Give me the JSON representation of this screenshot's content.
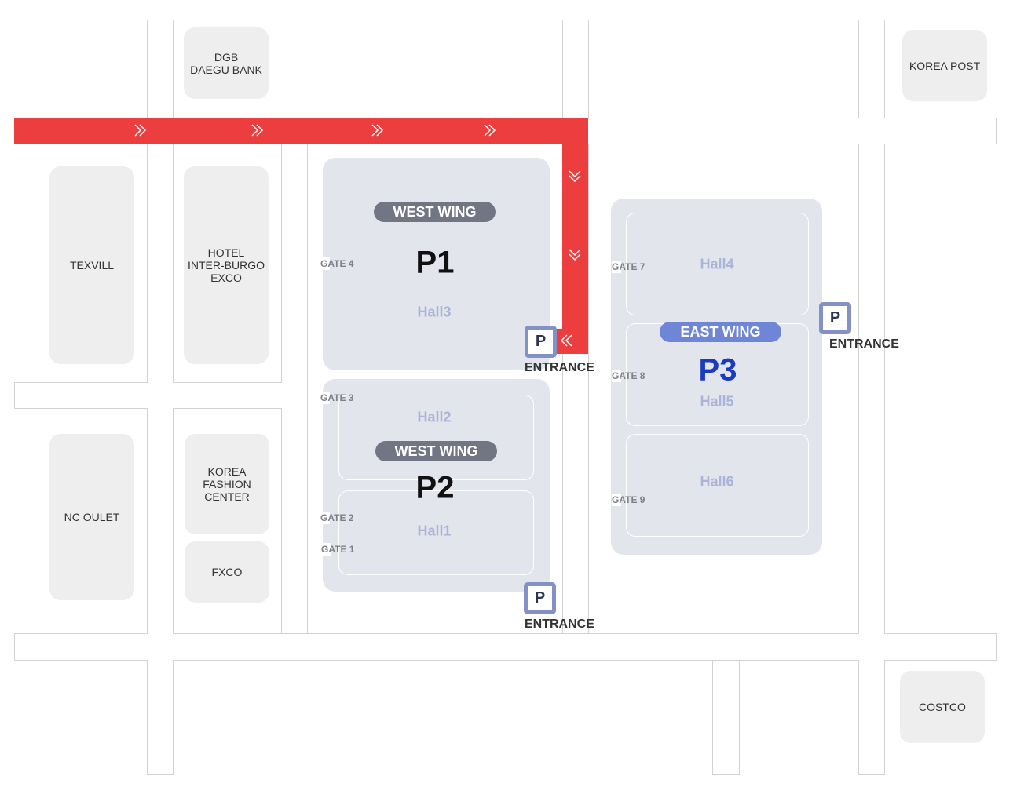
{
  "colors": {
    "route": "#ec3d3f",
    "west_wing": "#727584",
    "east_wing": "#6f86d6",
    "p3": "#1a3bbf",
    "hall_label": "#a9b4d8",
    "parking": "#8391c6"
  },
  "buildings": [
    {
      "id": "dgb",
      "label": "DGB\nDAEGU BANK"
    },
    {
      "id": "korea-post",
      "label": "KOREA POST"
    },
    {
      "id": "texvill",
      "label": "TEXVILL"
    },
    {
      "id": "hotel",
      "label": "HOTEL\nINTER-BURGO\nEXCO"
    },
    {
      "id": "nc-oulet",
      "label": "NC OULET"
    },
    {
      "id": "korea-fashion-center",
      "label": "KOREA\nFASHION\nCENTER"
    },
    {
      "id": "fxco",
      "label": "FXCO"
    },
    {
      "id": "costco",
      "label": "COSTCO"
    }
  ],
  "venues": {
    "p1": {
      "wing": "WEST WING",
      "name": "P1",
      "halls": [
        "Hall3"
      ]
    },
    "p2": {
      "wing": "WEST WING",
      "name": "P2",
      "halls": [
        "Hall2",
        "Hall1"
      ]
    },
    "p3": {
      "wing": "EAST WING",
      "name": "P3",
      "halls": [
        "Hall4",
        "Hall5",
        "Hall6"
      ]
    }
  },
  "gates": [
    "GATE 4",
    "GATE 3",
    "GATE 2",
    "GATE 1",
    "GATE 7",
    "GATE 8",
    "GATE 9"
  ],
  "parking": {
    "icon_label": "P",
    "entrance_label": "ENTRANCE",
    "icon": "parking-icon"
  },
  "route": {
    "icon": "double-chevron-icon"
  }
}
